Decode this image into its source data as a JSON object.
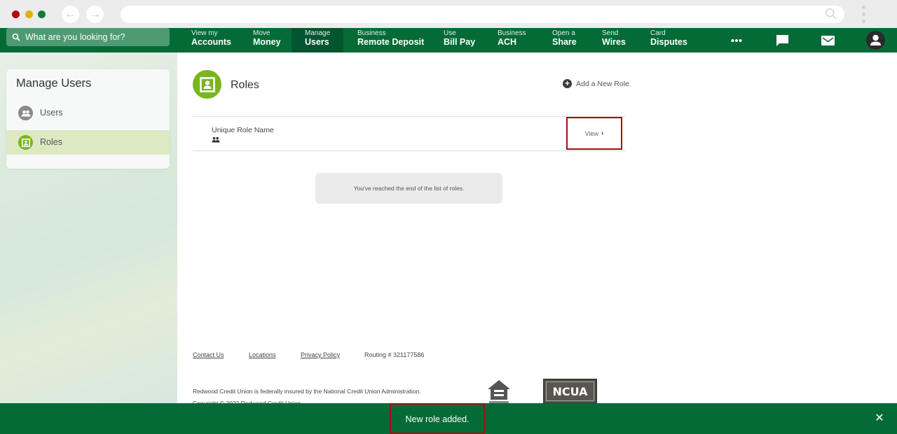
{
  "browser": {
    "back_icon": "arrow-left-icon",
    "forward_icon": "arrow-right-icon",
    "url": "",
    "search_icon": "search-icon",
    "menu_icon": "kebab-menu-icon"
  },
  "topnav": {
    "search_placeholder": "What are you looking for?",
    "items": [
      {
        "small": "View my",
        "big": "Accounts",
        "active": false
      },
      {
        "small": "Move",
        "big": "Money",
        "active": false
      },
      {
        "small": "Manage",
        "big": "Users",
        "active": true
      },
      {
        "small": "Business",
        "big": "Remote Deposit",
        "active": false
      },
      {
        "small": "Use",
        "big": "Bill Pay",
        "active": false
      },
      {
        "small": "Business",
        "big": "ACH",
        "active": false
      },
      {
        "small": "Open a",
        "big": "Share",
        "active": false
      },
      {
        "small": "Send",
        "big": "Wires",
        "active": false
      },
      {
        "small": "Card",
        "big": "Disputes",
        "active": false
      }
    ],
    "more_icon": "more-dots-icon",
    "chat_icon": "chat-bubble-icon",
    "mail_icon": "envelope-icon",
    "profile_icon": "user-avatar-icon"
  },
  "sidebar": {
    "title": "Manage Users",
    "items": [
      {
        "label": "Users",
        "icon": "users-group-icon",
        "selected": false
      },
      {
        "label": "Roles",
        "icon": "role-badge-icon",
        "selected": true
      }
    ]
  },
  "main": {
    "title": "Roles",
    "add_role_label": "Add a New Role",
    "roles": [
      {
        "name": "Unique Role Name",
        "view_label": "View"
      }
    ],
    "end_message": "You've reached the end of the list of roles."
  },
  "footer": {
    "links": [
      "Contact Us",
      "Locations",
      "Privacy Policy"
    ],
    "routing": "Routing # 321177586",
    "insured_text": "Redwood Credit Union is federally insured by the National Credit Union Administration.",
    "copyright": "Copyright © 2022 Redwood Credit Union",
    "ncua_label": "NCUA"
  },
  "toast": {
    "message": "New role added.",
    "close_label": "✕"
  },
  "colors": {
    "brand_green": "#046b37",
    "active_nav": "#035530",
    "accent_lime": "#7ab51d",
    "selected_row": "#dde9c3",
    "highlight_box": "#a50f0f"
  }
}
